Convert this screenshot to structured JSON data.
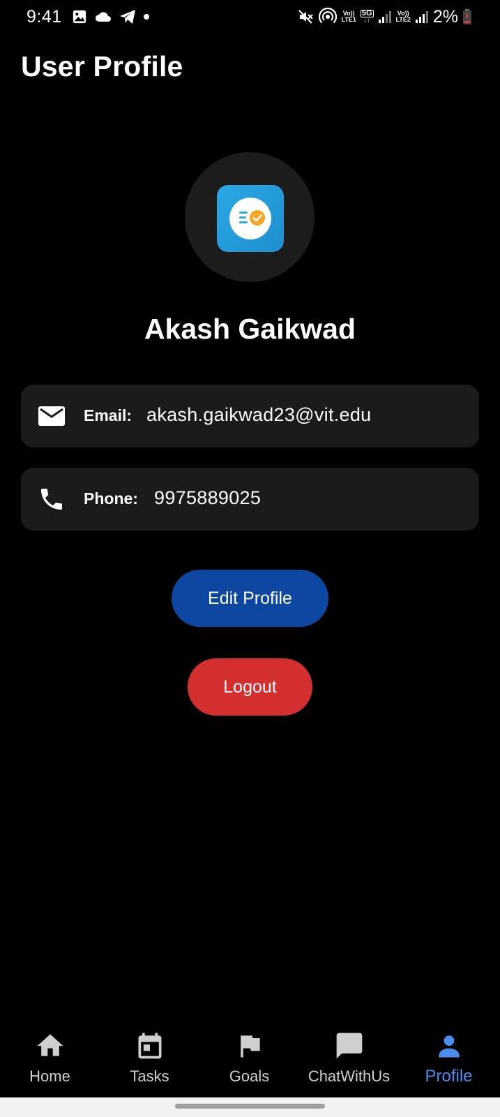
{
  "status_bar": {
    "time": "9:41",
    "battery_percent": "2%",
    "sim1_label_top": "Vo))",
    "sim1_label_bottom": "LTE1",
    "network_label": "5G",
    "sim2_label_top": "Vo))",
    "sim2_label_bottom": "LTE2",
    "icons": [
      "gallery-icon",
      "cloud-icon",
      "telegram-icon",
      "dot-icon",
      "mute-icon",
      "hotspot-icon",
      "signal-icon",
      "battery-low-icon"
    ]
  },
  "page": {
    "title": "User Profile"
  },
  "profile": {
    "name": "Akash Gaikwad",
    "email_label": "Email:",
    "email": "akash.gaikwad23@vit.edu",
    "phone_label": "Phone:",
    "phone": "9975889025"
  },
  "actions": {
    "edit_label": "Edit Profile",
    "logout_label": "Logout"
  },
  "colors": {
    "background": "#000000",
    "card": "#1b1b1b",
    "edit_button": "#0d47a1",
    "logout_button": "#d32f2f",
    "active_nav": "#4a8ff0",
    "logo_blue": "#2aa7e4",
    "logo_check": "#f5a623"
  },
  "bottom_nav": {
    "active": "Profile",
    "items": [
      {
        "label": "Home",
        "icon": "home-icon"
      },
      {
        "label": "Tasks",
        "icon": "calendar-icon"
      },
      {
        "label": "Goals",
        "icon": "flag-icon"
      },
      {
        "label": "ChatWithUs",
        "icon": "chat-icon"
      },
      {
        "label": "Profile",
        "icon": "person-icon"
      }
    ]
  }
}
